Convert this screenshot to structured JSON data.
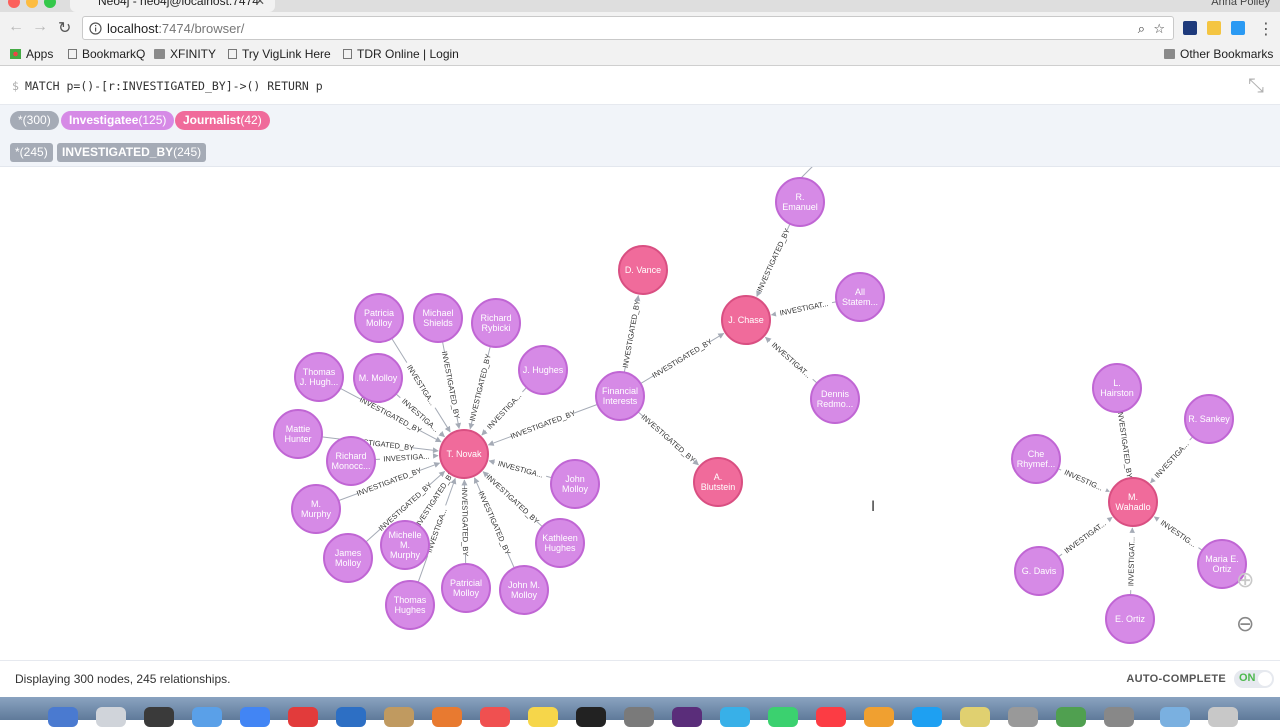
{
  "browser": {
    "tab_title": "Neo4j - neo4j@localhost:7474",
    "profile_name": "Anna Polley",
    "url_host": "localhost",
    "url_rest": ":7474/browser/"
  },
  "bookmarks": [
    {
      "label": "Apps",
      "icon": "apps-grid-icon"
    },
    {
      "label": "BookmarkQ",
      "icon": "page-icon"
    },
    {
      "label": "XFINITY",
      "icon": "folder-icon"
    },
    {
      "label": "Try VigLink Here",
      "icon": "page-icon"
    },
    {
      "label": "TDR Online | Login",
      "icon": "page-icon"
    }
  ],
  "other_bookmarks": "Other Bookmarks",
  "query": {
    "prompt": "$",
    "text": "MATCH p=()-[r:INVESTIGATED_BY]->() RETURN p"
  },
  "legend": {
    "all_nodes": {
      "label": "*",
      "count": "(300)"
    },
    "labels": [
      {
        "label": "Investigatee",
        "count": "(125)",
        "color": "#d68ae6"
      },
      {
        "label": "Journalist",
        "count": "(42)",
        "color": "#f06b9b"
      }
    ],
    "all_rels": {
      "label": "*",
      "count": "(245)"
    },
    "rel_types": [
      {
        "label": "INVESTIGATED_BY",
        "count": "(245)"
      }
    ]
  },
  "colors": {
    "investigatee": "#d68ae6",
    "investigatee_border": "#c066d4",
    "journalist": "#f06b9b",
    "journalist_border": "#d94f82",
    "edge": "#a5abb6"
  },
  "graph": {
    "nodes": [
      {
        "id": "novak",
        "lines": [
          "T. Novak"
        ],
        "kind": "journalist"
      },
      {
        "id": "patricia",
        "lines": [
          "Patricia",
          "Molloy"
        ],
        "kind": "investigatee"
      },
      {
        "id": "michael",
        "lines": [
          "Michael",
          "Shields"
        ],
        "kind": "investigatee"
      },
      {
        "id": "rybicki",
        "lines": [
          "Richard",
          "Rybicki"
        ],
        "kind": "investigatee"
      },
      {
        "id": "jhughes",
        "lines": [
          "J. Hughes"
        ],
        "kind": "investigatee"
      },
      {
        "id": "thomasj",
        "lines": [
          "Thomas",
          "J. Hugh..."
        ],
        "kind": "investigatee"
      },
      {
        "id": "mmolloy",
        "lines": [
          "M. Molloy"
        ],
        "kind": "investigatee"
      },
      {
        "id": "mattie",
        "lines": [
          "Mattie",
          "Hunter"
        ],
        "kind": "investigatee"
      },
      {
        "id": "monocc",
        "lines": [
          "Richard",
          "Monocc..."
        ],
        "kind": "investigatee"
      },
      {
        "id": "mmurphy",
        "lines": [
          "M.",
          "Murphy"
        ],
        "kind": "investigatee"
      },
      {
        "id": "james",
        "lines": [
          "James",
          "Molloy"
        ],
        "kind": "investigatee"
      },
      {
        "id": "michelle",
        "lines": [
          "Michelle",
          "M.",
          "Murphy"
        ],
        "kind": "investigatee"
      },
      {
        "id": "thomash",
        "lines": [
          "Thomas",
          "Hughes"
        ],
        "kind": "investigatee"
      },
      {
        "id": "patricial",
        "lines": [
          "Patricial",
          "Molloy"
        ],
        "kind": "investigatee"
      },
      {
        "id": "johnm",
        "lines": [
          "John M.",
          "Molloy"
        ],
        "kind": "investigatee"
      },
      {
        "id": "kathleen",
        "lines": [
          "Kathleen",
          "Hughes"
        ],
        "kind": "investigatee"
      },
      {
        "id": "john",
        "lines": [
          "John",
          "Molloy"
        ],
        "kind": "investigatee"
      },
      {
        "id": "financial",
        "lines": [
          "Financial",
          "Interests"
        ],
        "kind": "investigatee"
      },
      {
        "id": "vance",
        "lines": [
          "D. Vance"
        ],
        "kind": "journalist"
      },
      {
        "id": "blutstein",
        "lines": [
          "A.",
          "Blutstein"
        ],
        "kind": "journalist"
      },
      {
        "id": "chase",
        "lines": [
          "J. Chase"
        ],
        "kind": "journalist"
      },
      {
        "id": "emanuel",
        "lines": [
          "R.",
          "Emanuel"
        ],
        "kind": "investigatee"
      },
      {
        "id": "allstatem",
        "lines": [
          "All",
          "Statem..."
        ],
        "kind": "investigatee"
      },
      {
        "id": "dennis",
        "lines": [
          "Dennis",
          "Redmo..."
        ],
        "kind": "investigatee"
      },
      {
        "id": "wahadlo",
        "lines": [
          "M.",
          "Wahadlo"
        ],
        "kind": "journalist"
      },
      {
        "id": "hairston",
        "lines": [
          "L.",
          "Hairston"
        ],
        "kind": "investigatee"
      },
      {
        "id": "sankey",
        "lines": [
          "R. Sankey"
        ],
        "kind": "investigatee"
      },
      {
        "id": "che",
        "lines": [
          "Che",
          "Rhymef..."
        ],
        "kind": "investigatee"
      },
      {
        "id": "maria",
        "lines": [
          "Maria E.",
          "Ortiz"
        ],
        "kind": "investigatee"
      },
      {
        "id": "gdavis",
        "lines": [
          "G. Davis"
        ],
        "kind": "investigatee"
      },
      {
        "id": "eortiz",
        "lines": [
          "E. Ortiz"
        ],
        "kind": "investigatee"
      }
    ],
    "edges": [
      {
        "from": "patricia",
        "to": "novak",
        "label": "INVESTIGA..."
      },
      {
        "from": "michael",
        "to": "novak",
        "label": "INVESTIGATED_BY"
      },
      {
        "from": "rybicki",
        "to": "novak",
        "label": "INVESTIGATED_BY"
      },
      {
        "from": "jhughes",
        "to": "novak",
        "label": "INVESTIGA..."
      },
      {
        "from": "thomasj",
        "to": "novak",
        "label": "INVESTIGATED_BY"
      },
      {
        "from": "mmolloy",
        "to": "novak",
        "label": "INVESTIGA..."
      },
      {
        "from": "mattie",
        "to": "novak",
        "label": "INVESTIGATED_BY"
      },
      {
        "from": "monocc",
        "to": "novak",
        "label": "INVESTIGA..."
      },
      {
        "from": "mmurphy",
        "to": "novak",
        "label": "INVESTIGATED_BY"
      },
      {
        "from": "james",
        "to": "novak",
        "label": "INVESTIGATED_BY"
      },
      {
        "from": "michelle",
        "to": "novak",
        "label": "INVESTIGATED_BY"
      },
      {
        "from": "thomash",
        "to": "novak",
        "label": "INVESTIGA..."
      },
      {
        "from": "patricial",
        "to": "novak",
        "label": "INVESTIGATED_BY"
      },
      {
        "from": "johnm",
        "to": "novak",
        "label": "INVESTIGATED_BY"
      },
      {
        "from": "kathleen",
        "to": "novak",
        "label": "INVESTIGATED_BY"
      },
      {
        "from": "john",
        "to": "novak",
        "label": "INVESTIGA..."
      },
      {
        "from": "financial",
        "to": "novak",
        "label": "INVESTIGATED_BY"
      },
      {
        "from": "financial",
        "to": "vance",
        "label": "INVESTIGATED_BY"
      },
      {
        "from": "financial",
        "to": "blutstein",
        "label": "INVESTIGATED_BY"
      },
      {
        "from": "financial",
        "to": "chase",
        "label": "INVESTIGATED_BY"
      },
      {
        "from": "emanuel",
        "to": "chase",
        "label": "INVESTIGATED_BY"
      },
      {
        "from": "allstatem",
        "to": "chase",
        "label": "INVESTIGAT..."
      },
      {
        "from": "dennis",
        "to": "chase",
        "label": "INVESTIGAT..."
      },
      {
        "from": "hairston",
        "to": "wahadlo",
        "label": "INVESTIGATED_BY"
      },
      {
        "from": "sankey",
        "to": "wahadlo",
        "label": "INVESTIGA..."
      },
      {
        "from": "che",
        "to": "wahadlo",
        "label": "INVESTIG..."
      },
      {
        "from": "maria",
        "to": "wahadlo",
        "label": "INVESTIG..."
      },
      {
        "from": "gdavis",
        "to": "wahadlo",
        "label": "INVESTIGAT..."
      },
      {
        "from": "eortiz",
        "to": "wahadlo",
        "label": "INVESTIGAT..."
      }
    ]
  },
  "status": {
    "text": "Displaying 300 nodes, 245 relationships.",
    "autocomplete_label": "AUTO-COMPLETE",
    "autocomplete_state": "ON"
  }
}
